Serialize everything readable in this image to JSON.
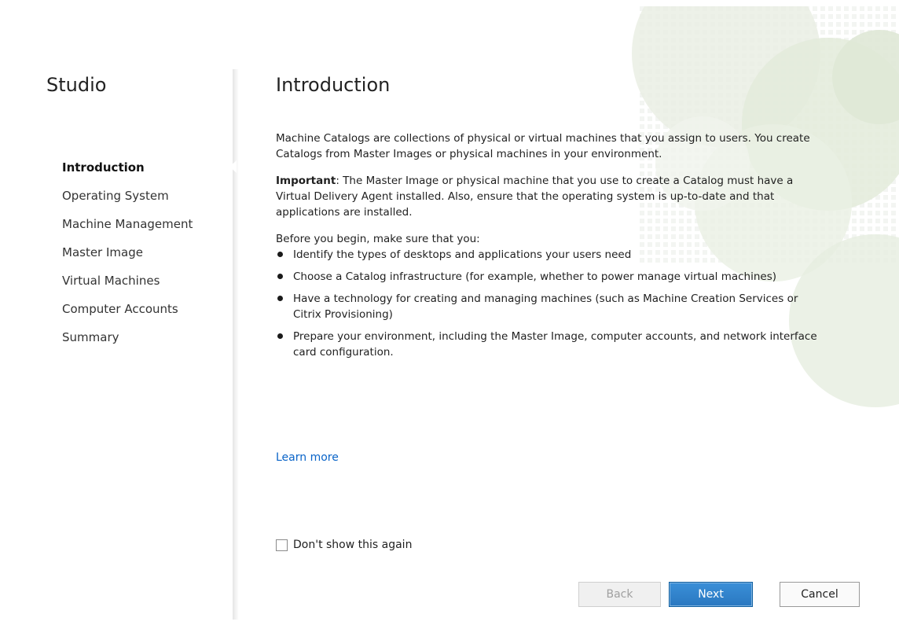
{
  "app": {
    "title": "Studio"
  },
  "steps": [
    {
      "label": "Introduction",
      "active": true
    },
    {
      "label": "Operating System",
      "active": false
    },
    {
      "label": "Machine Management",
      "active": false
    },
    {
      "label": "Master Image",
      "active": false
    },
    {
      "label": "Virtual Machines",
      "active": false
    },
    {
      "label": "Computer Accounts",
      "active": false
    },
    {
      "label": "Summary",
      "active": false
    }
  ],
  "page": {
    "title": "Introduction",
    "intro": "Machine Catalogs are collections of physical or virtual machines that you assign to users. You create Catalogs from Master Images or physical machines in your environment.",
    "important_label": "Important",
    "important_text": ": The Master Image or physical machine that you use to create a Catalog must have a Virtual Delivery Agent installed. Also, ensure that the operating system is up-to-date and that applications are installed.",
    "before_begin": "Before you begin, make sure that you:",
    "bullets": [
      "Identify the types of desktops and applications your users need",
      "Choose a Catalog infrastructure (for example, whether to power manage virtual machines)",
      "Have a technology for creating and managing machines (such as Machine Creation Services or Citrix Provisioning)",
      "Prepare your environment, including the Master Image, computer accounts, and network interface card configuration."
    ],
    "learn_more": "Learn more",
    "dont_show_label": "Don't show this again",
    "dont_show_checked": false
  },
  "buttons": {
    "back": "Back",
    "next": "Next",
    "cancel": "Cancel"
  },
  "colors": {
    "link": "#0a64c8",
    "primary": "#2a78c0",
    "decor": "#dfe8d6"
  }
}
